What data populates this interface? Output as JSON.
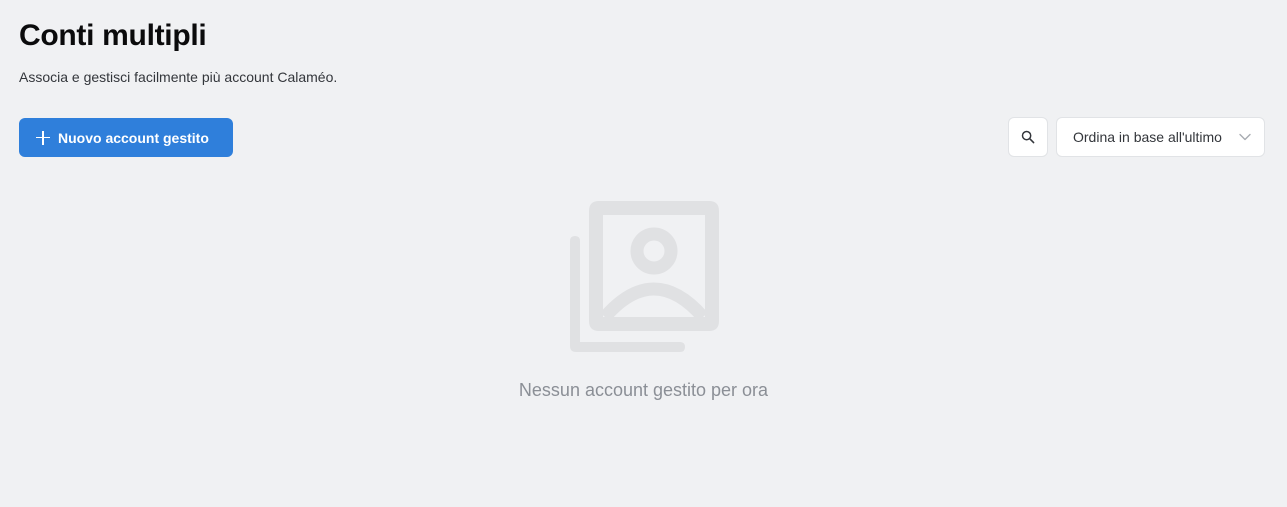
{
  "header": {
    "title": "Conti multipli",
    "subtitle": "Associa e gestisci facilmente più account Calaméo."
  },
  "toolbar": {
    "new_button_label": "Nuovo account gestito",
    "new_button_icon": "plus-icon",
    "search_icon": "search-icon",
    "sort_selected": "Ordina in base all'ultimo",
    "sort_icon": "chevron-down-icon"
  },
  "empty_state": {
    "icon": "image-stack-icon",
    "message": "Nessun account gestito per ora"
  },
  "colors": {
    "background": "#f0f1f3",
    "primary": "#2f7fdb",
    "empty_icon": "#e0e1e3",
    "empty_text": "#8b8f96"
  }
}
